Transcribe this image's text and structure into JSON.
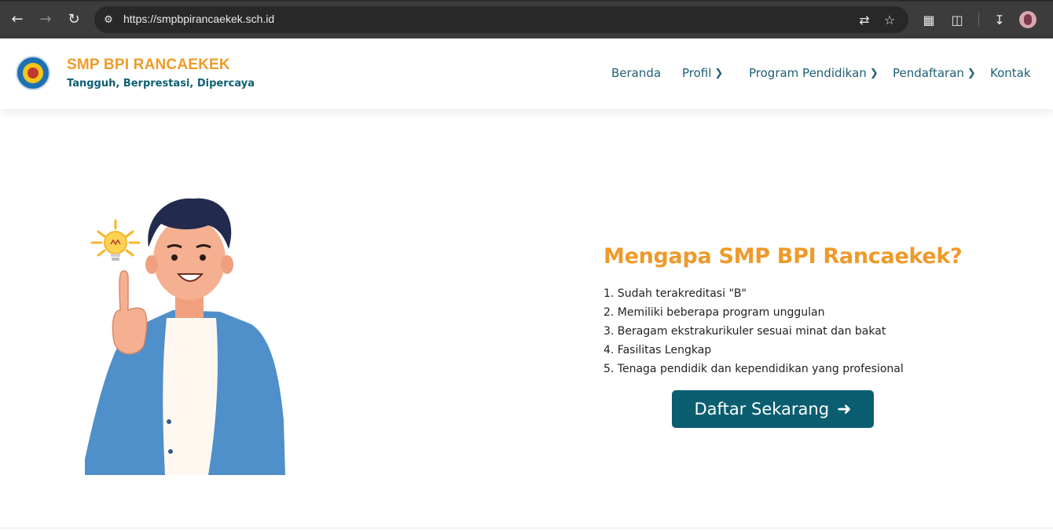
{
  "browser": {
    "url": "https://smpbpirancaekek.sch.id",
    "icons": [
      "back-icon",
      "forward-icon",
      "reload-icon",
      "site-settings-icon",
      "translate-icon",
      "bookmark-star-icon",
      "extension-icon",
      "puzzle-icon",
      "download-icon",
      "profile-avatar"
    ]
  },
  "site": {
    "name": "SMP BPI RANCAEKEK",
    "tagline": "Tangguh, Berprestasi, Dipercaya",
    "brand_color": "#ee9a2a",
    "accent_color": "#0a5e70"
  },
  "nav": {
    "beranda": "Beranda",
    "profil": "Profil",
    "program": "Program Pendidikan",
    "pendaftaran": "Pendaftaran",
    "kontak": "Kontak"
  },
  "hero": {
    "title": "Mengapa SMP BPI Rancaekek?",
    "reasons": [
      "1. Sudah terakreditasi \"B\"",
      "2. Memiliki beberapa program unggulan",
      "3. Beragam ekstrakurikuler sesuai minat dan bakat",
      "4. Fasilitas Lengkap",
      "5. Tenaga pendidik dan kependidikan yang profesional"
    ],
    "cta_label": "Daftar Sekarang"
  }
}
